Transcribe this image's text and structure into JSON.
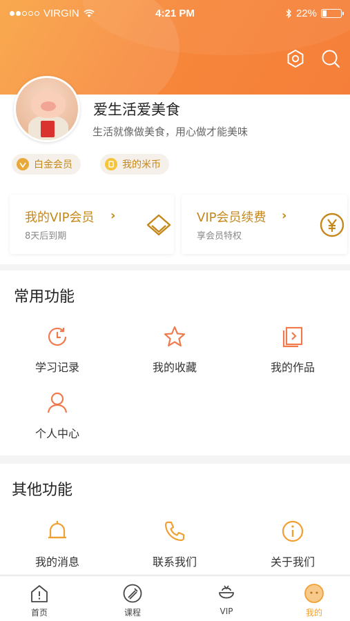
{
  "status_bar": {
    "carrier": "VIRGIN",
    "time": "4:21 PM",
    "battery": "22%",
    "battery_level": 0.22
  },
  "header": {
    "icons": [
      "settings-hex-icon",
      "search-icon"
    ]
  },
  "profile": {
    "username": "爱生活爱美食",
    "motto": "生活就像做美食，用心做才能美味",
    "badges": [
      {
        "label": "白金会员",
        "icon": "crown-badge-icon"
      },
      {
        "label": "我的米币",
        "icon": "coin-icon"
      }
    ]
  },
  "vip_cards": [
    {
      "title": "我的VIP会员",
      "subtitle": "8天后到期",
      "icon": "diamond-icon"
    },
    {
      "title": "VIP会员续费",
      "subtitle": "享会员特权",
      "icon": "yen-icon"
    }
  ],
  "common_functions": {
    "title": "常用功能",
    "items": [
      {
        "label": "学习记录",
        "icon": "clock-history-icon"
      },
      {
        "label": "我的收藏",
        "icon": "star-icon"
      },
      {
        "label": "我的作品",
        "icon": "works-icon"
      },
      {
        "label": "个人中心",
        "icon": "user-icon"
      }
    ]
  },
  "other_functions": {
    "title": "其他功能",
    "items": [
      {
        "label": "我的消息",
        "icon": "bell-icon"
      },
      {
        "label": "联系我们",
        "icon": "phone-icon"
      },
      {
        "label": "关于我们",
        "icon": "info-icon"
      }
    ]
  },
  "tabbar": {
    "items": [
      {
        "label": "首页",
        "icon": "home-icon"
      },
      {
        "label": "课程",
        "icon": "course-icon"
      },
      {
        "label": "VIP",
        "icon": "vip-icon"
      },
      {
        "label": "我的",
        "icon": "profile-face-icon",
        "active": true
      }
    ]
  },
  "colors": {
    "header_gradient": [
      "#f9a03c",
      "#f57f3a"
    ],
    "accent_gold": "#c5871a",
    "icon_orange": "#f0a032",
    "icon_coral": "#ef7a4e"
  }
}
